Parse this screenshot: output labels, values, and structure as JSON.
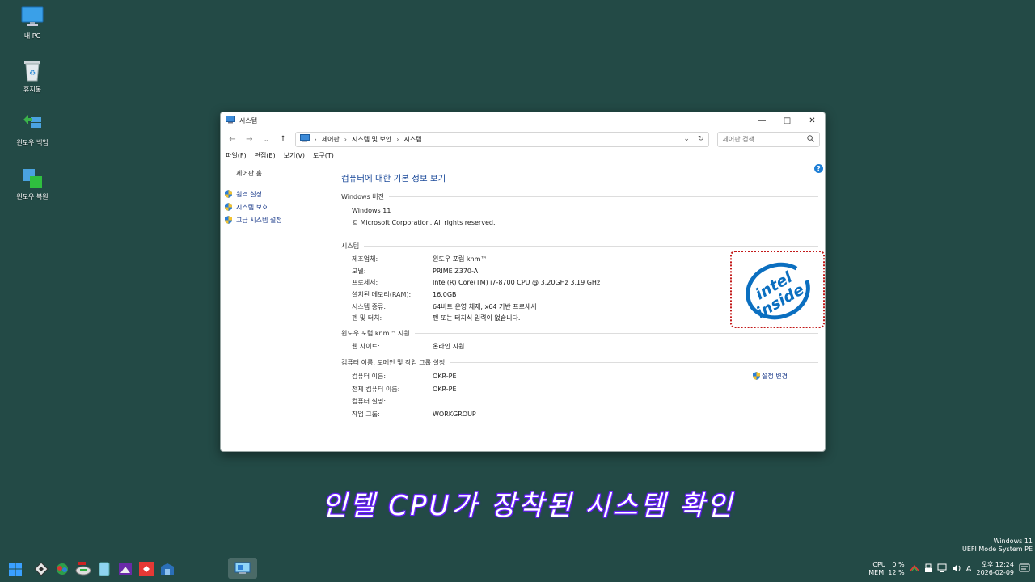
{
  "desktop": {
    "icons": [
      {
        "label": "내 PC",
        "icon": "monitor-icon"
      },
      {
        "label": "휴지통",
        "icon": "recycle-bin-icon"
      },
      {
        "label": "윈도우 백업",
        "icon": "backup-icon"
      },
      {
        "label": "윈도우 복원",
        "icon": "restore-icon"
      }
    ]
  },
  "window": {
    "title": "시스템",
    "address": {
      "crumbs": [
        "제어판",
        "시스템 및 보안",
        "시스템"
      ]
    },
    "search_placeholder": "제어판 검색",
    "menu": [
      "파일(F)",
      "편집(E)",
      "보기(V)",
      "도구(T)"
    ],
    "sidebar": {
      "home": "제어판 홈",
      "links": [
        "원격 설정",
        "시스템 보호",
        "고급 시스템 설정"
      ]
    },
    "main": {
      "title": "컴퓨터에 대한 기본 정보 보기",
      "windows_edition": {
        "heading": "Windows 버전",
        "name": "Windows 11",
        "copyright": "© Microsoft Corporation. All rights reserved."
      },
      "system": {
        "heading": "시스템",
        "rows": [
          {
            "k": "제조업체:",
            "v": "윈도우 포럼 knm™"
          },
          {
            "k": "모델:",
            "v": "PRIME Z370-A"
          },
          {
            "k": "프로세서:",
            "v": "Intel(R) Core(TM) i7-8700 CPU @ 3.20GHz   3.19 GHz"
          },
          {
            "k": "설치된 메모리(RAM):",
            "v": "16.0GB"
          },
          {
            "k": "시스템 종류:",
            "v": "64비트 운영 체제, x64 기반 프로세서"
          },
          {
            "k": "펜 및 터치:",
            "v": "펜 또는 터치식 입력이 없습니다."
          }
        ]
      },
      "support": {
        "heading": "윈도우 포럼 knm™ 지원",
        "website_k": "웹 사이트:",
        "website_v": "온라인 지원"
      },
      "computer": {
        "heading": "컴퓨터 이름, 도메인 및 작업 그룹 설정",
        "change_label": "설정 변경",
        "rows": [
          {
            "k": "컴퓨터 이름:",
            "v": "OKR-PE"
          },
          {
            "k": "전체 컴퓨터 이름:",
            "v": "OKR-PE"
          },
          {
            "k": "컴퓨터 설명:",
            "v": ""
          },
          {
            "k": "작업 그룹:",
            "v": "WORKGROUP"
          }
        ]
      },
      "logo": {
        "line1": "intel",
        "line2": "inside",
        "color": "#0b6fc0",
        "highlight_color": "#c31a1a"
      }
    }
  },
  "caption": "인텔 CPU가 장착된 시스템 확인",
  "os_info": {
    "line1": "Windows 11",
    "line2": "UEFI Mode System PE"
  },
  "tray": {
    "cpu": "CPU :   0 %",
    "mem": "MEM:  12 %",
    "time": "오후 12:24",
    "date": "2026-02-09",
    "ime": "A"
  },
  "colors": {
    "desktop": "#234a46",
    "link_blue": "#1b4a9a",
    "caption_glow": "#6a1bff"
  }
}
